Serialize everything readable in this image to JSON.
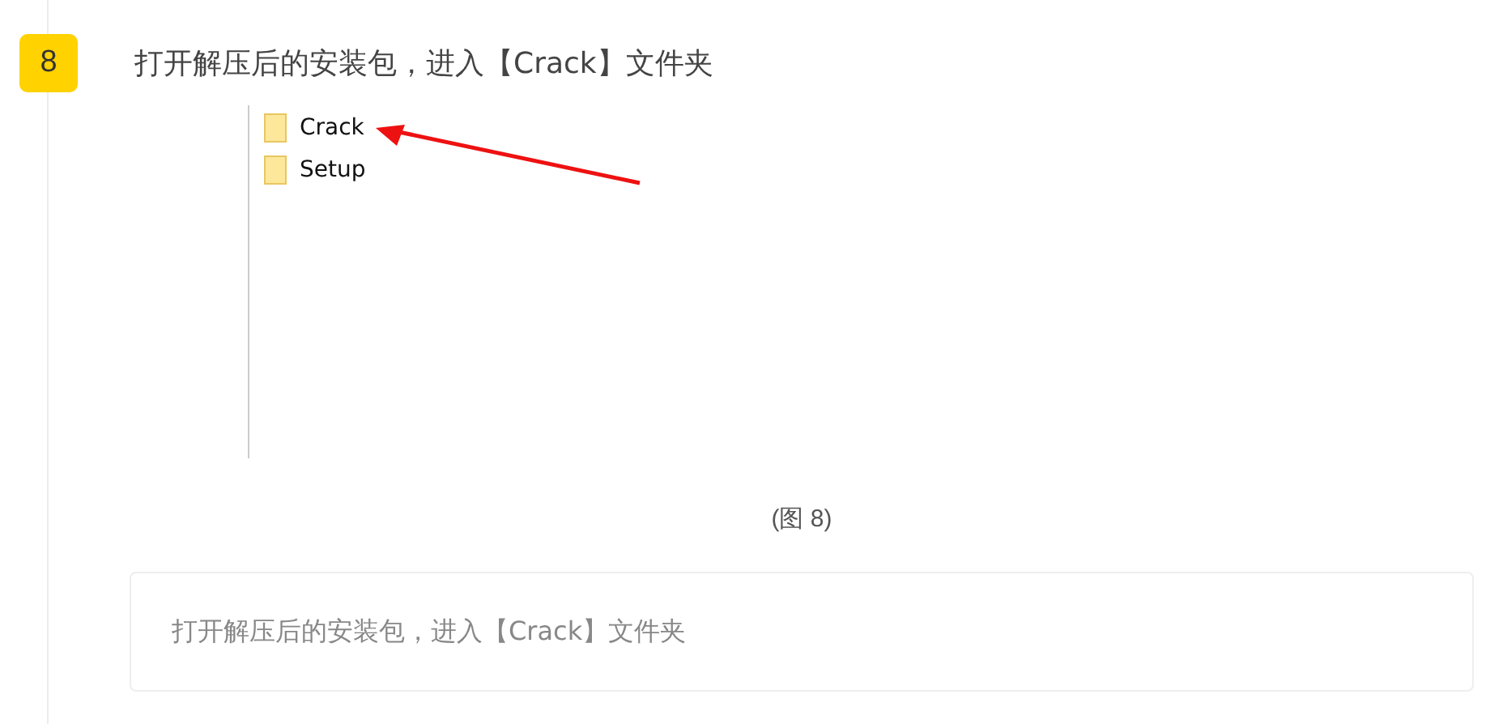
{
  "step": {
    "number": "8",
    "title": "打开解压后的安装包，进入【Crack】文件夹"
  },
  "figure": {
    "folders": [
      {
        "name": "Crack"
      },
      {
        "name": "Setup"
      }
    ],
    "caption": "(图 8)"
  },
  "note": "打开解压后的安装包，进入【Crack】文件夹"
}
